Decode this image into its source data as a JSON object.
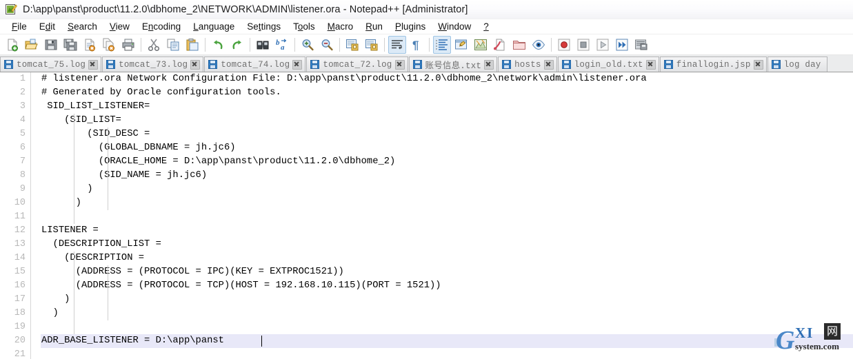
{
  "window": {
    "icon": "notepadpp-chameleon-icon",
    "title": "D:\\app\\panst\\product\\11.2.0\\dbhome_2\\NETWORK\\ADMIN\\listener.ora - Notepad++ [Administrator]"
  },
  "menu": {
    "items": [
      {
        "name": "file",
        "label": "File",
        "accel": "F"
      },
      {
        "name": "edit",
        "label": "Edit",
        "accel": "E"
      },
      {
        "name": "search",
        "label": "Search",
        "accel": "S"
      },
      {
        "name": "view",
        "label": "View",
        "accel": "V"
      },
      {
        "name": "encoding",
        "label": "Encoding",
        "accel": "n"
      },
      {
        "name": "language",
        "label": "Language",
        "accel": "L"
      },
      {
        "name": "settings",
        "label": "Settings",
        "accel": "t"
      },
      {
        "name": "tools",
        "label": "Tools",
        "accel": "o"
      },
      {
        "name": "macro",
        "label": "Macro",
        "accel": "M"
      },
      {
        "name": "run",
        "label": "Run",
        "accel": "R"
      },
      {
        "name": "plugins",
        "label": "Plugins",
        "accel": "P"
      },
      {
        "name": "window",
        "label": "Window",
        "accel": "W"
      },
      {
        "name": "help",
        "label": "?",
        "accel": "?"
      }
    ]
  },
  "toolbar": {
    "buttons": [
      {
        "name": "new-file-icon",
        "title": "New"
      },
      {
        "name": "open-file-icon",
        "title": "Open"
      },
      {
        "name": "save-icon",
        "title": "Save"
      },
      {
        "name": "save-all-icon",
        "title": "Save All"
      },
      {
        "name": "close-file-icon",
        "title": "Close"
      },
      {
        "name": "close-all-icon",
        "title": "Close All"
      },
      {
        "name": "print-icon",
        "title": "Print"
      },
      {
        "name": "separator-1",
        "title": ""
      },
      {
        "name": "cut-icon",
        "title": "Cut"
      },
      {
        "name": "copy-icon",
        "title": "Copy"
      },
      {
        "name": "paste-icon",
        "title": "Paste"
      },
      {
        "name": "separator-2",
        "title": ""
      },
      {
        "name": "undo-icon",
        "title": "Undo"
      },
      {
        "name": "redo-icon",
        "title": "Redo"
      },
      {
        "name": "separator-3",
        "title": ""
      },
      {
        "name": "find-icon",
        "title": "Find"
      },
      {
        "name": "replace-icon",
        "title": "Replace"
      },
      {
        "name": "separator-4",
        "title": ""
      },
      {
        "name": "zoom-in-icon",
        "title": "Zoom In"
      },
      {
        "name": "zoom-out-icon",
        "title": "Zoom Out"
      },
      {
        "name": "separator-5",
        "title": ""
      },
      {
        "name": "sync-vertical-icon",
        "title": "Synchronize Vertical Scrolling"
      },
      {
        "name": "sync-horizontal-icon",
        "title": "Synchronize Horizontal Scrolling"
      },
      {
        "name": "separator-6",
        "title": ""
      },
      {
        "name": "word-wrap-icon",
        "title": "Word Wrap"
      },
      {
        "name": "show-all-chars-icon",
        "title": "Show All Characters"
      },
      {
        "name": "separator-7",
        "title": ""
      },
      {
        "name": "indent-guide-icon",
        "title": "Show Indent Guide"
      },
      {
        "name": "user-defined-dlg-icon",
        "title": "User Defined Dialogue"
      },
      {
        "name": "doc-map-icon",
        "title": "Document Map"
      },
      {
        "name": "function-list-icon",
        "title": "Function List"
      },
      {
        "name": "folder-workspace-icon",
        "title": "Folder as Workspace"
      },
      {
        "name": "monitoring-icon",
        "title": "Monitoring"
      },
      {
        "name": "separator-8",
        "title": ""
      },
      {
        "name": "record-macro-icon",
        "title": "Start Recording"
      },
      {
        "name": "stop-macro-icon",
        "title": "Stop Recording"
      },
      {
        "name": "play-macro-icon",
        "title": "Playback"
      },
      {
        "name": "play-multi-icon",
        "title": "Run a Macro Multiple Times"
      },
      {
        "name": "save-macro-icon",
        "title": "Save Current Recorded Macro"
      }
    ]
  },
  "tabs": [
    {
      "name": "tab-tomcat-75-log",
      "label": "tomcat_75.log",
      "active": false
    },
    {
      "name": "tab-tomcat-73-log",
      "label": "tomcat_73.log",
      "active": false
    },
    {
      "name": "tab-tomcat-74-log",
      "label": "tomcat_74.log",
      "active": false
    },
    {
      "name": "tab-tomcat-72-log",
      "label": "tomcat_72.log",
      "active": false
    },
    {
      "name": "tab-zhanghao-txt",
      "label": "账号信息.txt",
      "active": false
    },
    {
      "name": "tab-hosts",
      "label": "hosts",
      "active": false
    },
    {
      "name": "tab-login-old-txt",
      "label": "login_old.txt",
      "active": false
    },
    {
      "name": "tab-finallogin-jsp",
      "label": "finallogin.jsp",
      "active": false
    },
    {
      "name": "tab-log-day",
      "label": "log day",
      "active": false
    }
  ],
  "editor": {
    "current_line": 20,
    "lines": [
      {
        "n": "1",
        "text": "# listener.ora Network Configuration File: D:\\app\\panst\\product\\11.2.0\\dbhome_2\\network\\admin\\listener.ora"
      },
      {
        "n": "2",
        "text": "# Generated by Oracle configuration tools."
      },
      {
        "n": "3",
        "text": " SID_LIST_LISTENER="
      },
      {
        "n": "4",
        "text": "    (SID_LIST="
      },
      {
        "n": "5",
        "text": "        (SID_DESC ="
      },
      {
        "n": "6",
        "text": "          (GLOBAL_DBNAME = jh.jc6)"
      },
      {
        "n": "7",
        "text": "          (ORACLE_HOME = D:\\app\\panst\\product\\11.2.0\\dbhome_2)"
      },
      {
        "n": "8",
        "text": "          (SID_NAME = jh.jc6)"
      },
      {
        "n": "9",
        "text": "        )"
      },
      {
        "n": "10",
        "text": "      )"
      },
      {
        "n": "11",
        "text": ""
      },
      {
        "n": "12",
        "text": "LISTENER ="
      },
      {
        "n": "13",
        "text": "  (DESCRIPTION_LIST ="
      },
      {
        "n": "14",
        "text": "    (DESCRIPTION ="
      },
      {
        "n": "15",
        "text": "      (ADDRESS = (PROTOCOL = IPC)(KEY = EXTPROC1521))"
      },
      {
        "n": "16",
        "text": "      (ADDRESS = (PROTOCOL = TCP)(HOST = 192.168.10.115)(PORT = 1521))"
      },
      {
        "n": "17",
        "text": "    )"
      },
      {
        "n": "18",
        "text": "  )"
      },
      {
        "n": "19",
        "text": ""
      },
      {
        "n": "20",
        "text": "ADR_BASE_LISTENER = D:\\app\\panst"
      },
      {
        "n": "21",
        "text": ""
      }
    ]
  },
  "watermark": {
    "g": "G",
    "xi": "XI",
    "net": "网",
    "domain": "system.com"
  },
  "colors": {
    "current_line": "#e8e8f8",
    "gutter_text": "#b8b8b8",
    "tab_text": "#6f6f6f",
    "accent": "#2f6fb5"
  }
}
